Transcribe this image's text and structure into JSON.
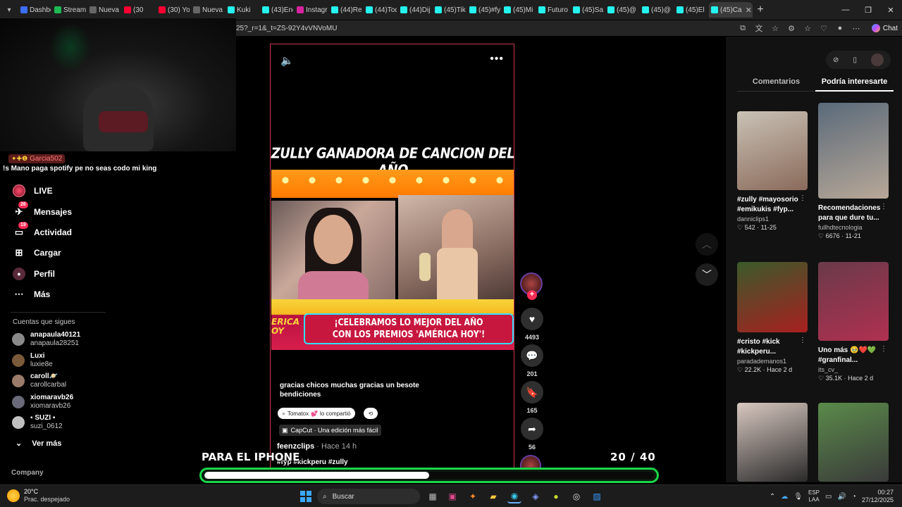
{
  "browser": {
    "tabs": [
      {
        "label": "Dashbo",
        "color": "#3b6dff"
      },
      {
        "label": "Stream",
        "color": "#1db954"
      },
      {
        "label": "Nueva",
        "color": "#666666"
      },
      {
        "label": "(30",
        "color": "#ff0033"
      },
      {
        "label": "(30) Yo",
        "color": "#ff0033"
      },
      {
        "label": "Nueva",
        "color": "#666666"
      },
      {
        "label": "Kuki",
        "color": "#25f4ee"
      },
      {
        "label": "(43)Enc",
        "color": "#25f4ee"
      },
      {
        "label": "Instagr",
        "color": "#d6249f"
      },
      {
        "label": "(44)Res",
        "color": "#25f4ee"
      },
      {
        "label": "(44)Tod",
        "color": "#25f4ee"
      },
      {
        "label": "(44)Dij",
        "color": "#25f4ee"
      },
      {
        "label": "(45)Tik",
        "color": "#25f4ee"
      },
      {
        "label": "(45)#fy",
        "color": "#25f4ee"
      },
      {
        "label": "(45)Mi",
        "color": "#25f4ee"
      },
      {
        "label": "Futuro",
        "color": "#25f4ee"
      },
      {
        "label": "(45)Sa",
        "color": "#25f4ee"
      },
      {
        "label": "(45)@",
        "color": "#25f4ee"
      },
      {
        "label": "(45)@",
        "color": "#25f4ee"
      },
      {
        "label": "(45)El",
        "color": "#25f4ee"
      },
      {
        "label": "(45)Ca",
        "color": "#25f4ee"
      }
    ],
    "url": "25?_r=1&_t=ZS-92Y4vVNVoMU",
    "chat_label": "Chat"
  },
  "stream_chat": {
    "username": "Garcia502",
    "message": "!s Mano paga spotify pe no seas codo mi king"
  },
  "sidebar": {
    "nav": [
      {
        "label": "LIVE",
        "icon": "live-icon",
        "badge": ""
      },
      {
        "label": "Mensajes",
        "icon": "messages-icon",
        "badge": "26"
      },
      {
        "label": "Actividad",
        "icon": "activity-icon",
        "badge": "19"
      },
      {
        "label": "Cargar",
        "icon": "upload-icon",
        "badge": ""
      },
      {
        "label": "Perfil",
        "icon": "profile-icon",
        "badge": ""
      },
      {
        "label": "Más",
        "icon": "more-icon",
        "badge": ""
      }
    ],
    "following_title": "Cuentas que sigues",
    "following": [
      {
        "name": "anapaula40121",
        "handle": "anapaula28251",
        "color": "#8a8a8a"
      },
      {
        "name": "Luxi",
        "handle": "luxie8e",
        "color": "#7a5a3a"
      },
      {
        "name": "caroll🪐",
        "handle": "carollcarbal",
        "color": "#9a7a6a"
      },
      {
        "name": "xiomaravb26",
        "handle": "xiomaravb26",
        "color": "#6a6a7a"
      },
      {
        "name": "▪ SUZI ▪",
        "handle": "suzi_0612",
        "color": "#c0c0c0"
      }
    ],
    "see_more": "Ver más",
    "company": "Company"
  },
  "video": {
    "title": "ZULLY GANADORA DE CANCION DEL AÑO",
    "banner_line1": "¡CELEBRAMOS LO MEJOR DEL AÑO",
    "banner_line2": "CON LOS PREMIOS 'AMÉRICA HOY'!",
    "banner_logo": "ERICA\nOY",
    "description": "gracias chicos muchas gracias un besote bendiciones",
    "share_chip": "Tomatox",
    "share_chip_suffix": "lo compartió",
    "capcut": "CapCut · Una edición más fácil",
    "author": "feenzclips",
    "ago": "· Hace 14 h",
    "hashtags": "#fyp #kickperu #zully"
  },
  "actions": {
    "likes": "4493",
    "comments": "201",
    "saves": "165",
    "shares": "56"
  },
  "right_panel": {
    "tabs": [
      "Comentarios",
      "Podría interesarte"
    ],
    "active_tab": 1,
    "cards": [
      {
        "title": "#zully #mayosorio #emikukis #fyp...",
        "user": "danniclips1",
        "stats": "♡ 542 · 11-25",
        "colors": [
          "#c9c2b6",
          "#8a6a5a"
        ]
      },
      {
        "title": "Recomendaciones para que dure tu...",
        "user": "fullhdtecnologia",
        "stats": "♡ 6676 · 11-21",
        "colors": [
          "#5a6a7a",
          "#b8a898"
        ]
      },
      {
        "title": "#cristo #kick #kickperu...",
        "user": "paradademanos1",
        "stats": "♡ 22.2K · Hace 2 d",
        "colors": [
          "#3a5a2a",
          "#a82020"
        ]
      },
      {
        "title": "Uno más 🥹❤️💚 #granfinal...",
        "user": "its_cv_",
        "stats": "♡ 35.1K · Hace 2 d",
        "colors": [
          "#6a3a4a",
          "#b03050"
        ]
      },
      {
        "title": "",
        "user": "",
        "stats": "",
        "colors": [
          "#d8c8c0",
          "#2a2a2a"
        ]
      },
      {
        "title": "",
        "user": "",
        "stats": "",
        "colors": [
          "#5a8a4a",
          "#3a3a3a"
        ]
      }
    ]
  },
  "overlay": {
    "caption": "PARA EL IPHONE",
    "current": "20",
    "total": "40",
    "progress_fraction": 0.5
  },
  "taskbar": {
    "temperature": "20°C",
    "weather": "Prac. despejado",
    "search": "Buscar",
    "lang1": "ESP",
    "lang2": "LAA",
    "time": "00:27",
    "date": "27/12/2025"
  }
}
